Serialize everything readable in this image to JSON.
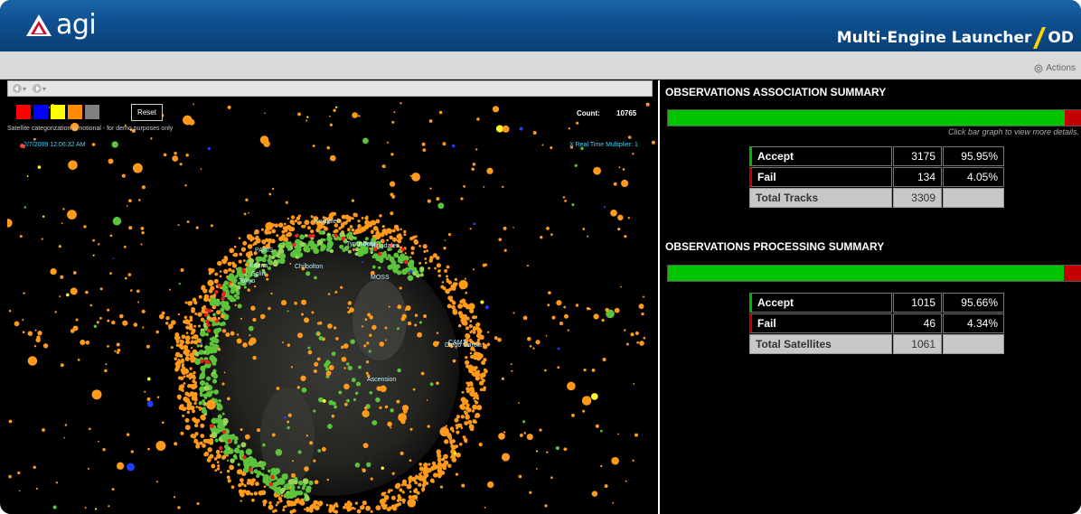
{
  "header": {
    "logo_text": "agi",
    "app_title_left": "Multi-Engine Launcher",
    "app_title_right": "OD"
  },
  "toolbar": {
    "actions_label": "Actions"
  },
  "viewer": {
    "swatches": [
      "#ff0000",
      "#0000ff",
      "#ffff00",
      "#ff8c00",
      "#808080"
    ],
    "reset_label": "Reset",
    "notional_text": "Satellite categorization is notional - for demo purposes only",
    "count_label": "Count:",
    "count_value": "10765",
    "timestamp": "2/7/2009 12:06:32 AM",
    "multiplier_text": "X Real Time Multiplier: 1",
    "site_labels": [
      "PARIS",
      "Chilbolton",
      "Eglin",
      "Tokyo",
      "Tyngsboro",
      "MOSS",
      "Ascension",
      "CAM3",
      "Fylingdales",
      "Kwajalein",
      "Kaena",
      "Diego Garcia"
    ]
  },
  "association": {
    "title": "OBSERVATIONS ASSOCIATION SUMMARY",
    "hint": "Click bar graph to view more details.",
    "accept_fraction": 0.9595,
    "rows": [
      {
        "label": "Accept",
        "value": "3175",
        "pct": "95.95%"
      },
      {
        "label": "Fail",
        "value": "134",
        "pct": "4.05%"
      },
      {
        "label": "Total Tracks",
        "value": "3309",
        "pct": ""
      }
    ]
  },
  "processing": {
    "title": "OBSERVATIONS PROCESSING SUMMARY",
    "accept_fraction": 0.9566,
    "rows": [
      {
        "label": "Accept",
        "value": "1015",
        "pct": "95.66%"
      },
      {
        "label": "Fail",
        "value": "46",
        "pct": "4.34%"
      },
      {
        "label": "Total Satellites",
        "value": "1061",
        "pct": ""
      }
    ]
  },
  "colors": {
    "accept": "#00c400",
    "fail": "#c40000",
    "header": "#0e4f8f"
  }
}
